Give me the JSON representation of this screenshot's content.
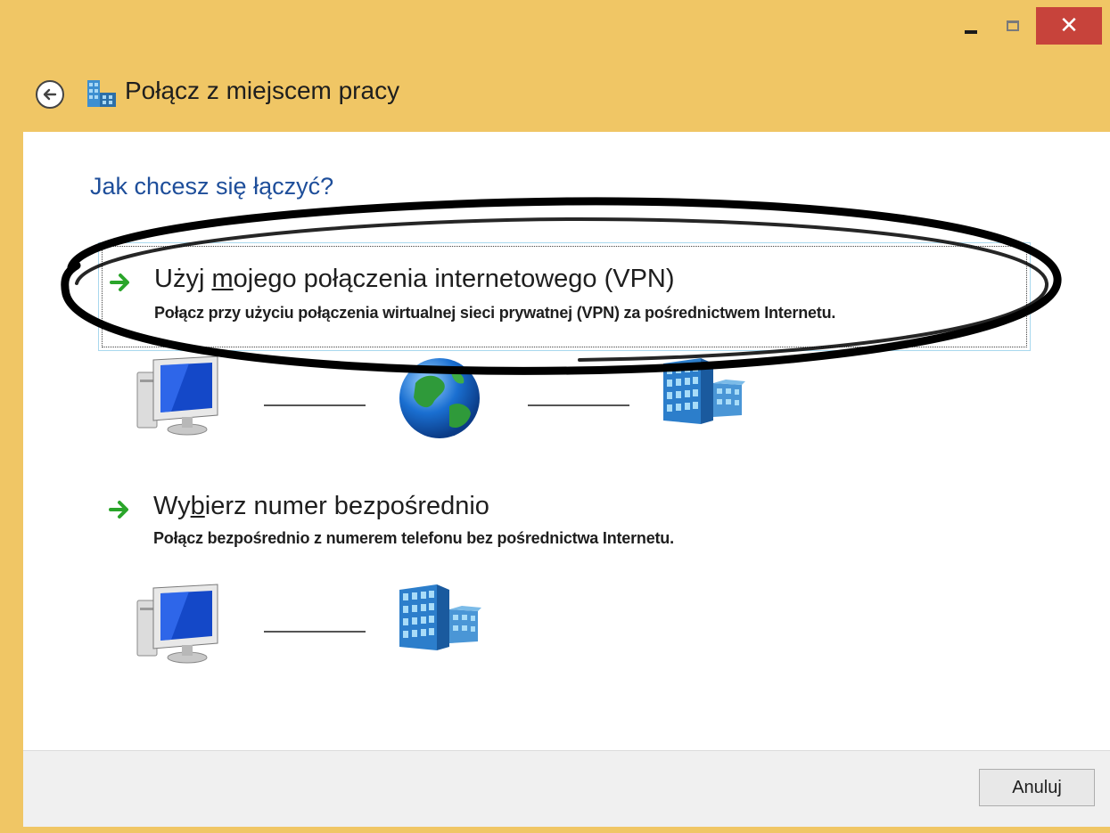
{
  "window": {
    "title": "Połącz z miejscem pracy",
    "close_glyph": "✕"
  },
  "page": {
    "question": "Jak chcesz się łączyć?"
  },
  "options": [
    {
      "title_pre": "Użyj ",
      "title_access": "m",
      "title_post": "ojego połączenia internetowego (VPN)",
      "description": "Połącz przy użyciu połączenia wirtualnej sieci prywatnej (VPN) za pośrednictwem Internetu.",
      "icons": [
        "computer-icon",
        "globe-icon",
        "building-icon"
      ]
    },
    {
      "title_pre": "Wy",
      "title_access": "b",
      "title_post": "ierz numer bezpośrednio",
      "description": "Połącz bezpośrednio z numerem telefonu bez pośrednictwa Internetu.",
      "icons": [
        "computer-icon",
        "building-icon"
      ]
    }
  ],
  "footer": {
    "cancel_label": "Anuluj"
  },
  "colors": {
    "titlebar": "#f0c665",
    "close": "#c7433b",
    "heading": "#1e4e9a",
    "arrow": "#2aa52a",
    "annotation": "#000000"
  }
}
